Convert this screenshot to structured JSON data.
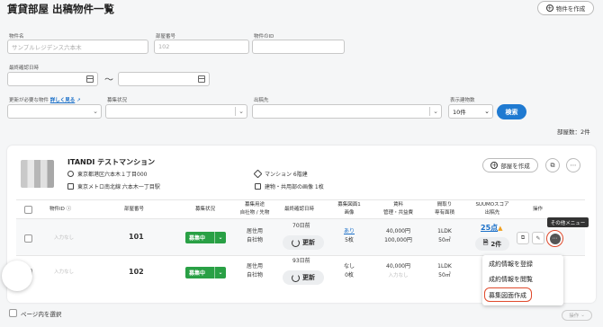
{
  "page": {
    "title": "賃貸部屋 出稿物件一覧",
    "create_button": "物件を作成"
  },
  "filters": {
    "property_name_label": "物件名",
    "property_name_placeholder": "サンプルレジデンス六本木",
    "room_number_label": "部屋番号",
    "room_number_placeholder": "102",
    "property_id_label": "物件のID",
    "last_confirmed_label": "最終確認日時",
    "range_separator": "〜",
    "update_needed_label": "更新が必要な物件",
    "update_needed_link": "詳しく見る",
    "recruit_status_label": "募集状況",
    "publish_to_label": "出稿先",
    "display_count_label": "表示建物数",
    "display_count_value": "10件",
    "search_button": "検索"
  },
  "summary": {
    "room_count": "部屋数：2件"
  },
  "property": {
    "name": "ITANDI テストマンション",
    "address": "東京都港区六本木１丁目000",
    "station": "東京メトロ南北線 六本木一丁目駅",
    "building_type": "マンション 6階建",
    "images": "建物・共用部の画像 1枚",
    "add_room_button": "部屋を作成"
  },
  "table": {
    "headers": {
      "property_id": "物件ID",
      "room_number": "部屋番号",
      "recruit_status": "募集状況",
      "usage_line1": "募集用途",
      "usage_line2": "自社物 / 先物",
      "last_confirmed": "最終確認日時",
      "floor_plan_line1": "募集図面1",
      "floor_plan_line2": "画像",
      "rent_line1": "賃料",
      "rent_line2": "管理・共益費",
      "layout_line1": "間取り",
      "layout_line2": "専有面積",
      "suumo_line1": "SUUMOスコア",
      "suumo_line2": "出稿先",
      "actions": "操作"
    },
    "rows": [
      {
        "property_id": "入力なし",
        "room_number": "101",
        "status": "募集中",
        "usage": "居住用",
        "ownership": "自社物",
        "days_ago": "70日前",
        "refresh": "更新",
        "floor_plan": "あり",
        "images": "5枚",
        "rent": "40,000円",
        "fee": "100,000円",
        "layout": "1LDK",
        "area": "50㎡",
        "score": "25点",
        "publish_count": "2件"
      },
      {
        "property_id": "入力なし",
        "room_number": "102",
        "status": "募集中",
        "usage": "居住用",
        "ownership": "自社物",
        "days_ago": "93日前",
        "refresh": "更新",
        "floor_plan": "なし",
        "images": "0枚",
        "rent": "40,000円",
        "fee": "入力なし",
        "layout": "1LDK",
        "area": "50㎡",
        "score": "",
        "publish_count": ""
      }
    ]
  },
  "tooltip": "その他メニュー",
  "menu": {
    "items": [
      "成約情報を登録",
      "成約情報を閲覧",
      "募集図面作成"
    ]
  },
  "footer": {
    "select_page": "ページ内を選択",
    "operation": "操作"
  },
  "colors": {
    "primary": "#1f7ad1",
    "status_green": "#29a045",
    "highlight": "#e04a2c"
  }
}
